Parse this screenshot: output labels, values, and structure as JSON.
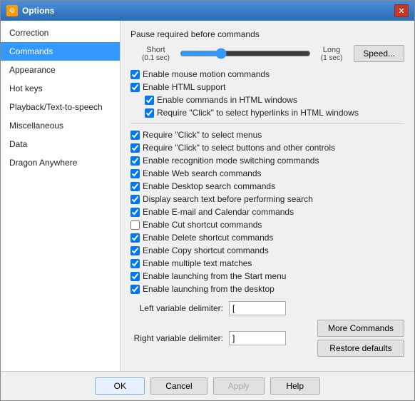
{
  "window": {
    "title": "Options",
    "close_label": "✕"
  },
  "sidebar": {
    "items": [
      {
        "label": "Correction",
        "active": false
      },
      {
        "label": "Commands",
        "active": true
      },
      {
        "label": "Appearance",
        "active": false
      },
      {
        "label": "Hot keys",
        "active": false
      },
      {
        "label": "Playback/Text-to-speech",
        "active": false
      },
      {
        "label": "Miscellaneous",
        "active": false
      },
      {
        "label": "Data",
        "active": false
      },
      {
        "label": "Dragon Anywhere",
        "active": false
      }
    ]
  },
  "main": {
    "pause_label": "Pause required before commands",
    "slider": {
      "left_label": "Short",
      "left_sub": "(0.1 sec)",
      "right_label": "Long",
      "right_sub": "(1 sec)",
      "value": 30
    },
    "speed_button": "Speed...",
    "checkboxes": [
      {
        "label": "Enable mouse motion commands",
        "checked": true,
        "indent": 0
      },
      {
        "label": "Enable HTML support",
        "checked": true,
        "indent": 0
      },
      {
        "label": "Enable commands in HTML windows",
        "checked": true,
        "indent": 1
      },
      {
        "label": "Require \"Click\" to select hyperlinks in HTML windows",
        "checked": true,
        "indent": 1
      }
    ],
    "checkboxes2": [
      {
        "label": "Require \"Click\" to select menus",
        "checked": true,
        "indent": 0
      },
      {
        "label": "Require \"Click\" to select buttons and other controls",
        "checked": true,
        "indent": 0
      },
      {
        "label": "Enable recognition mode switching commands",
        "checked": true,
        "indent": 0
      },
      {
        "label": "Enable Web search commands",
        "checked": true,
        "indent": 0
      },
      {
        "label": "Enable Desktop search commands",
        "checked": true,
        "indent": 0
      },
      {
        "label": "Display search text before performing search",
        "checked": true,
        "indent": 0
      },
      {
        "label": "Enable E-mail and Calendar commands",
        "checked": true,
        "indent": 0
      },
      {
        "label": "Enable Cut shortcut commands",
        "checked": false,
        "indent": 0
      },
      {
        "label": "Enable Delete shortcut commands",
        "checked": true,
        "indent": 0
      },
      {
        "label": "Enable Copy shortcut commands",
        "checked": true,
        "indent": 0
      },
      {
        "label": "Enable multiple text matches",
        "checked": true,
        "indent": 0
      },
      {
        "label": "Enable launching from the Start menu",
        "checked": true,
        "indent": 0
      },
      {
        "label": "Enable launching from the desktop",
        "checked": true,
        "indent": 0
      }
    ],
    "left_delimiter_label": "Left variable delimiter:",
    "left_delimiter_value": "[",
    "right_delimiter_label": "Right variable delimiter:",
    "right_delimiter_value": "]",
    "more_commands_btn": "More Commands",
    "restore_defaults_btn": "Restore defaults"
  },
  "footer": {
    "ok": "OK",
    "cancel": "Cancel",
    "apply": "Apply",
    "help": "Help"
  }
}
